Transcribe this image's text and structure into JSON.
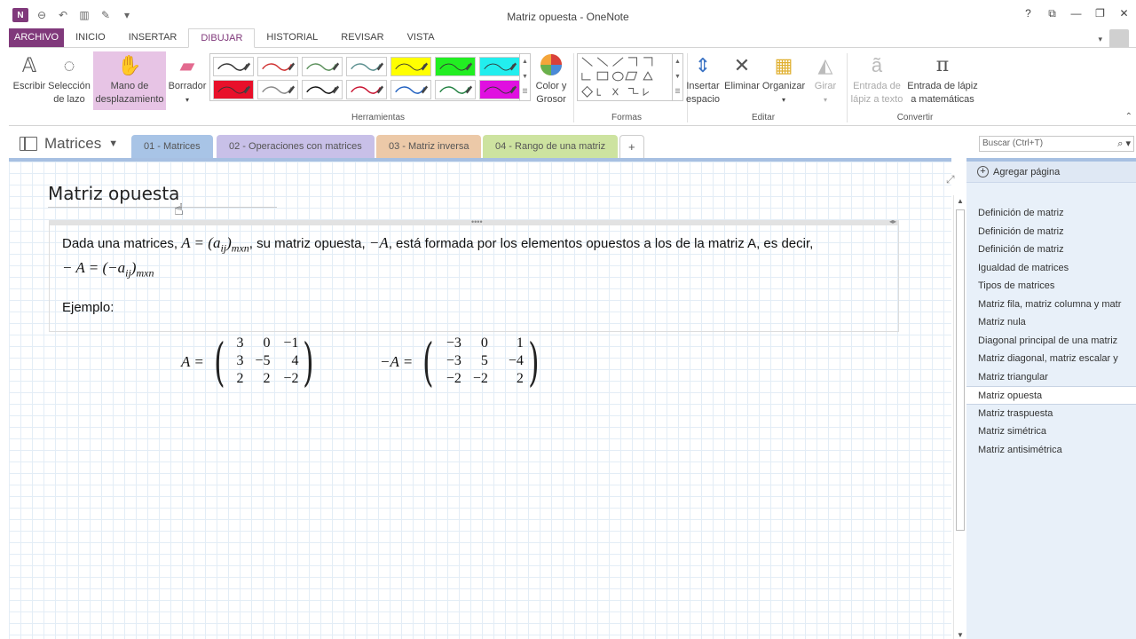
{
  "window": {
    "title": "Matriz opuesta - OneNote",
    "controls": [
      "?",
      "⧉",
      "—",
      "❐",
      "✕"
    ]
  },
  "qat": {
    "logo": "N"
  },
  "ribbon_tabs": [
    {
      "label": "ARCHIVO",
      "type": "file"
    },
    {
      "label": "INICIO"
    },
    {
      "label": "INSERTAR"
    },
    {
      "label": "DIBUJAR",
      "active": true
    },
    {
      "label": "HISTORIAL"
    },
    {
      "label": "REVISAR"
    },
    {
      "label": "VISTA"
    }
  ],
  "ribbon": {
    "escribir": "Escribir",
    "seleccion_1": "Selección",
    "seleccion_2": "de lazo",
    "mano_1": "Mano de",
    "mano_2": "desplazamiento",
    "borrador": "Borrador",
    "color_1": "Color y",
    "color_2": "Grosor",
    "insertar_1": "Insertar",
    "insertar_2": "espacio",
    "eliminar": "Eliminar",
    "organizar": "Organizar",
    "girar": "Girar",
    "entrada_texto_1": "Entrada de",
    "entrada_texto_2": "lápiz a texto",
    "entrada_mate_1": "Entrada de lápiz",
    "entrada_mate_2": "a matemáticas",
    "group_herramientas": "Herramientas",
    "group_formas": "Formas",
    "group_editar": "Editar",
    "group_convertir": "Convertir"
  },
  "pens": [
    {
      "color": "#333333",
      "bg": "#ffffff"
    },
    {
      "color": "#d03030",
      "bg": "#ffffff"
    },
    {
      "color": "#5a8f5a",
      "bg": "#ffffff"
    },
    {
      "color": "#5a8f8f",
      "bg": "#ffffff"
    },
    {
      "color": "#ffff00",
      "bg": "#ffff00"
    },
    {
      "color": "#22ee22",
      "bg": "#22ee22"
    },
    {
      "color": "#22eeee",
      "bg": "#22eeee"
    },
    {
      "color": "#e8102a",
      "bg": "#e8102a"
    },
    {
      "color": "#888888",
      "bg": "#ffffff"
    },
    {
      "color": "#111111",
      "bg": "#ffffff"
    },
    {
      "color": "#c8102e",
      "bg": "#ffffff"
    },
    {
      "color": "#2060c0",
      "bg": "#ffffff"
    },
    {
      "color": "#208040",
      "bg": "#ffffff"
    },
    {
      "color": "#e010e0",
      "bg": "#e010e0"
    }
  ],
  "notebook": {
    "name": "Matrices",
    "sections": [
      {
        "label": "01 - Matrices",
        "color": "#a8c4e6",
        "active": true
      },
      {
        "label": "02 - Operaciones con matrices",
        "color": "#c8c0e8"
      },
      {
        "label": "03 - Matriz inversa",
        "color": "#ecc9a8"
      },
      {
        "label": "04 - Rango de una matriz",
        "color": "#cde3a0"
      },
      {
        "label": "+",
        "color": "#ffffff"
      }
    ],
    "search_placeholder": "Buscar (Ctrl+T)"
  },
  "page": {
    "title": "Matriz opuesta",
    "para1_a": "Dada una matrices, ",
    "para1_b": ", su matriz opuesta, ",
    "para1_c": ", está formada por los elementos opuestos a los de la matriz A, es decir,",
    "math_A_def": "A = (a",
    "math_ij": "ij",
    "math_mxn": "mxn",
    "math_negA": "−A",
    "math_line2": "− A = (−a",
    "ejemplo": "Ejemplo:",
    "matrix_A_label": "A =",
    "matrix_A": [
      "3",
      "0",
      "−1",
      "3",
      "−5",
      "4",
      "2",
      "2",
      "−2"
    ],
    "matrix_negA_label": "−A =",
    "matrix_negA": [
      "−3",
      "0",
      "1",
      "−3",
      "5",
      "−4",
      "−2",
      "−2",
      "2"
    ]
  },
  "pages_pane": {
    "add_label": "Agregar página",
    "items": [
      "Definición de matriz",
      "Definición de matriz",
      "Definición de matriz",
      "Igualdad de matrices",
      "Tipos de matrices",
      "Matriz fila, matriz columna y matr",
      "Matriz nula",
      "Diagonal principal de una matriz",
      "Matriz diagonal, matriz escalar y",
      "Matriz triangular",
      "Matriz opuesta",
      "Matriz traspuesta",
      "Matriz simétrica",
      "Matriz antisimétrica"
    ],
    "selected_index": 10
  }
}
